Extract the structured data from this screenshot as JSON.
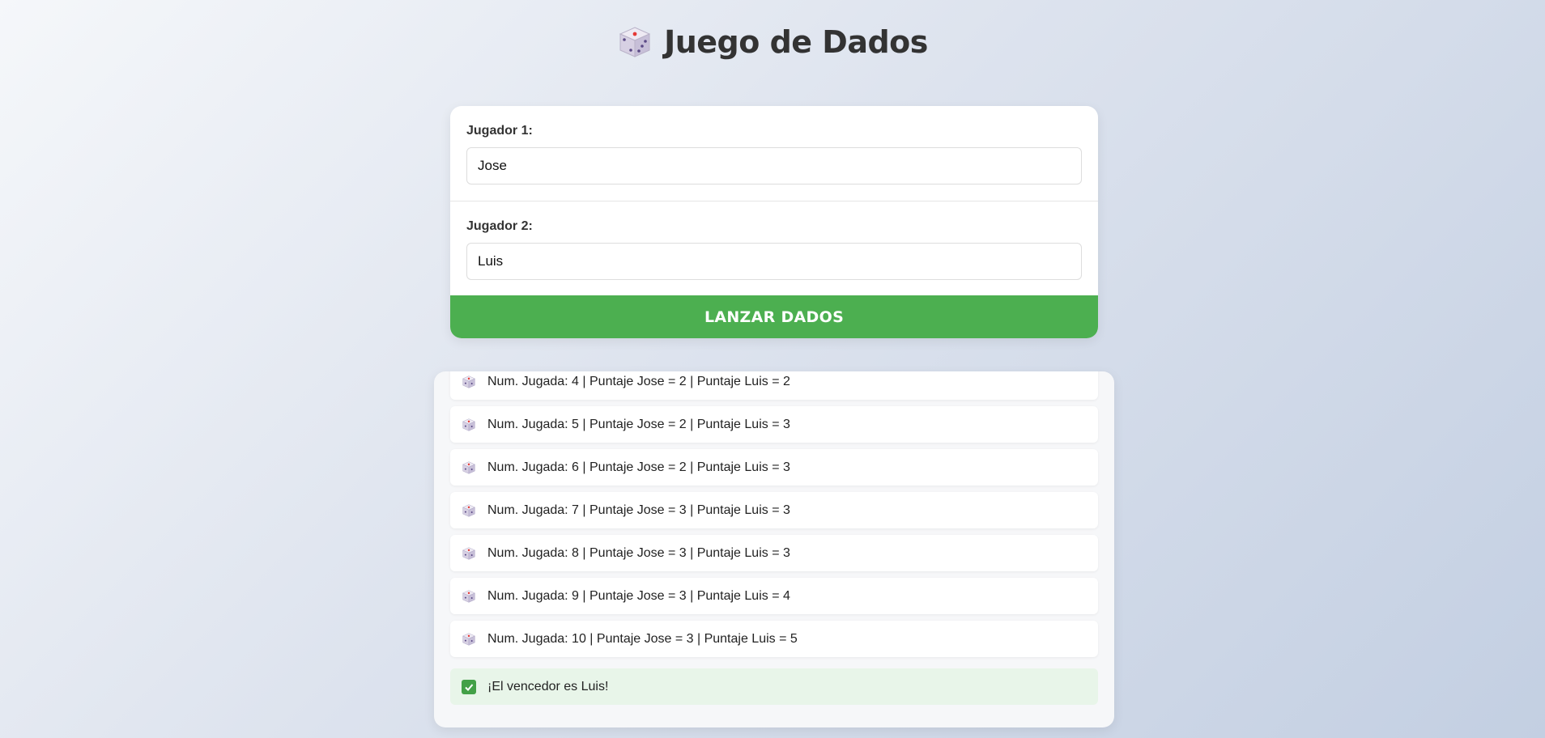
{
  "header": {
    "title": "Juego de Dados",
    "icon": "dice-icon"
  },
  "form": {
    "player1": {
      "label": "Jugador 1:",
      "value": "Jose"
    },
    "player2": {
      "label": "Jugador 2:",
      "value": "Luis"
    },
    "roll_button_label": "LANZAR DADOS"
  },
  "results": {
    "items": [
      "Num. Jugada: 4 | Puntaje Jose = 2 | Puntaje Luis = 2",
      "Num. Jugada: 5 | Puntaje Jose = 2 | Puntaje Luis = 3",
      "Num. Jugada: 6 | Puntaje Jose = 2 | Puntaje Luis = 3",
      "Num. Jugada: 7 | Puntaje Jose = 3 | Puntaje Luis = 3",
      "Num. Jugada: 8 | Puntaje Jose = 3 | Puntaje Luis = 3",
      "Num. Jugada: 9 | Puntaje Jose = 3 | Puntaje Luis = 4",
      "Num. Jugada: 10 | Puntaje Jose = 3 | Puntaje Luis = 5"
    ],
    "winner": "¡El vencedor es Luis!"
  },
  "colors": {
    "accent": "#4caf50",
    "winner_bg": "#e8f5e9",
    "check": "#43a047"
  }
}
